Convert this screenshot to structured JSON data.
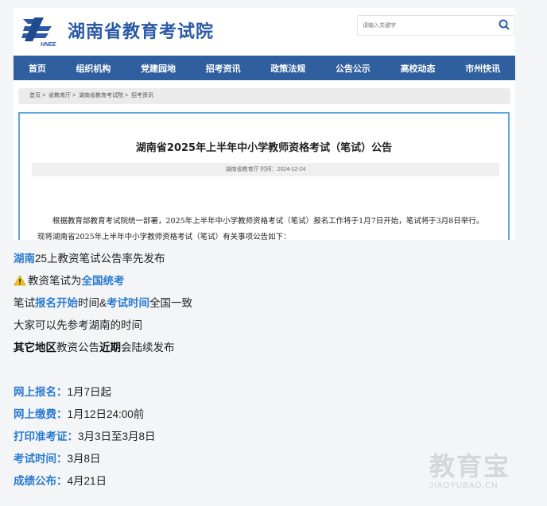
{
  "site": {
    "title": "湖南省教育考试院",
    "logo_text": "HNEE"
  },
  "search": {
    "placeholder": "请输入关键字"
  },
  "nav": [
    "首页",
    "组织机构",
    "党建园地",
    "招考资讯",
    "政策法规",
    "公告公示",
    "高校动态",
    "市州快讯"
  ],
  "breadcrumb": [
    "首页 >",
    "省教育厅 >",
    "湖南省教育考试院 >",
    "招考资讯"
  ],
  "article": {
    "title": "湖南省2025年上半年中小学教师资格考试（笔试）公告",
    "meta": "湖南省教育厅  时间：2024-12-24",
    "paragraph": "根据教育部教育考试院统一部署，2025年上半年中小学教师资格考试（笔试）报名工作将于1月7日开始，笔试将于3月8日举行。现将湖南省2025年上半年中小学教师资格考试（笔试）有关事项公告如下："
  },
  "post": {
    "l1": {
      "a": "湖南",
      "b": "25上教资笔试公告率先发布"
    },
    "l2": {
      "a": "教资笔试为",
      "b": "全国统考"
    },
    "l3": {
      "a": "笔试",
      "b": "报名开始",
      "c": "时间&",
      "d": "考试时间",
      "e": "全国一致"
    },
    "l4": "大家可以先参考湖南的时间",
    "l5": {
      "a": "其它地区",
      "b": "教资公告",
      "c": "近期",
      "d": "会陆续发布"
    },
    "schedule": [
      {
        "label": "网上报名：",
        "value": "1月7日起"
      },
      {
        "label": "网上缴费：",
        "value": "1月12日24:00前"
      },
      {
        "label": "打印准考证：",
        "value": "3月3日至3月8日"
      },
      {
        "label": "考试时间：",
        "value": "3月8日"
      },
      {
        "label": "成绩公布：",
        "value": "4月21日"
      }
    ]
  },
  "watermark": {
    "main": "教育宝",
    "sub": "JIAOYUBAO.CN"
  },
  "colors": {
    "nav": "#2f5f9e",
    "accent": "#2a7bd2",
    "panel_border": "#5aa8de",
    "title": "#2a5aa6"
  }
}
